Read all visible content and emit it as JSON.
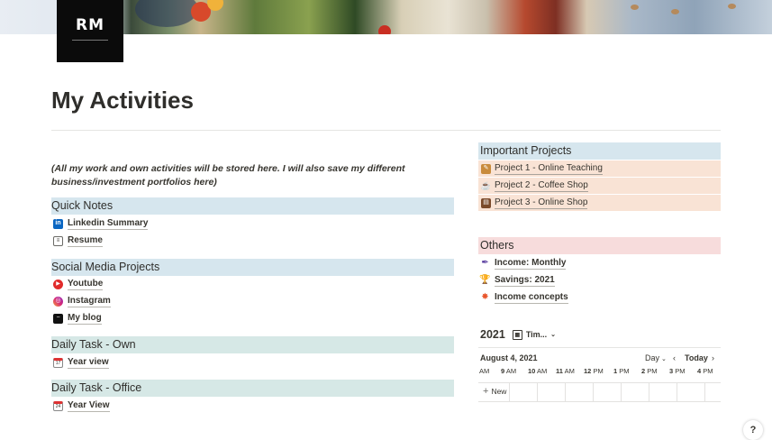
{
  "cover": {
    "logo_text": "RM"
  },
  "page": {
    "title": "My Activities",
    "intro": "(All my work and own activities will be stored here. I will also save my different business/investment portfolios here)"
  },
  "left": {
    "quick_notes": {
      "title": "Quick Notes",
      "items": [
        {
          "label": "Linkedin Summary",
          "icon": "linkedin-icon"
        },
        {
          "label": "Resume",
          "icon": "resume-icon"
        }
      ]
    },
    "social": {
      "title": "Social Media Projects",
      "items": [
        {
          "label": "Youtube",
          "icon": "youtube-icon"
        },
        {
          "label": "Instagram",
          "icon": "instagram-icon"
        },
        {
          "label": "My blog",
          "icon": "blog-icon"
        }
      ]
    },
    "daily_own": {
      "title": "Daily Task - Own",
      "items": [
        {
          "label": "Year view",
          "icon": "calendar-icon"
        }
      ]
    },
    "daily_office": {
      "title": "Daily Task - Office",
      "items": [
        {
          "label": "Year View",
          "icon": "calendar-icon"
        }
      ]
    }
  },
  "right": {
    "important": {
      "title": "Important Projects",
      "items": [
        {
          "label": "Project 1 - Online Teaching",
          "icon": "teacher-icon"
        },
        {
          "label": "Project 2 - Coffee Shop",
          "icon": "coffee-icon"
        },
        {
          "label": "Project 3 - Online Shop",
          "icon": "shop-icon"
        }
      ]
    },
    "others": {
      "title": "Others",
      "items": [
        {
          "label": "Income: Monthly",
          "icon": "feather-icon"
        },
        {
          "label": "Savings: 2021",
          "icon": "trophy-icon"
        },
        {
          "label": "Income concepts",
          "icon": "sparkle-icon"
        }
      ]
    }
  },
  "calendar": {
    "title": "2021",
    "view_label": "Tim...",
    "date": "August 4, 2021",
    "mode": "Day",
    "today": "Today",
    "hours": [
      {
        "n": "",
        "s": "AM"
      },
      {
        "n": "9",
        "s": "AM"
      },
      {
        "n": "10",
        "s": "AM"
      },
      {
        "n": "11",
        "s": "AM"
      },
      {
        "n": "12",
        "s": "PM"
      },
      {
        "n": "1",
        "s": "PM"
      },
      {
        "n": "2",
        "s": "PM"
      },
      {
        "n": "3",
        "s": "PM"
      },
      {
        "n": "4",
        "s": "PM"
      }
    ],
    "new_label": "New"
  },
  "help": {
    "label": "?"
  },
  "colors": {
    "blue": "#d6e6ee",
    "teal": "#d6e8e6",
    "pink": "#f7dcdc",
    "peach": "#f9e3d5"
  }
}
